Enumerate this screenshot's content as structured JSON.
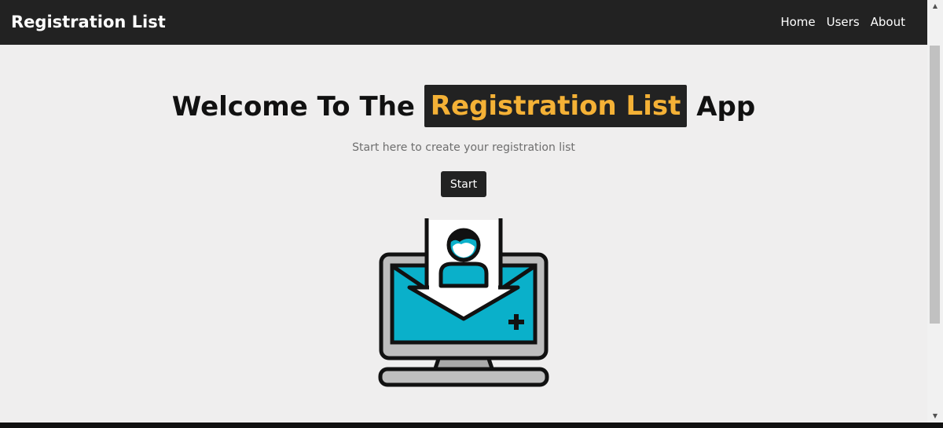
{
  "navbar": {
    "brand": "Registration List",
    "links": [
      {
        "label": "Home"
      },
      {
        "label": "Users"
      },
      {
        "label": "About"
      }
    ]
  },
  "hero": {
    "title_prefix": "Welcome To The",
    "title_highlight": "Registration List",
    "title_suffix": "App",
    "subtitle": "Start here to create your registration list",
    "start_label": "Start"
  },
  "illustration": {
    "icon": "registration-laptop-icon"
  },
  "colors": {
    "navbar_bg": "#222222",
    "highlight_text": "#f4b136",
    "page_bg": "#efeeee",
    "screen_teal": "#0ab0ca"
  }
}
